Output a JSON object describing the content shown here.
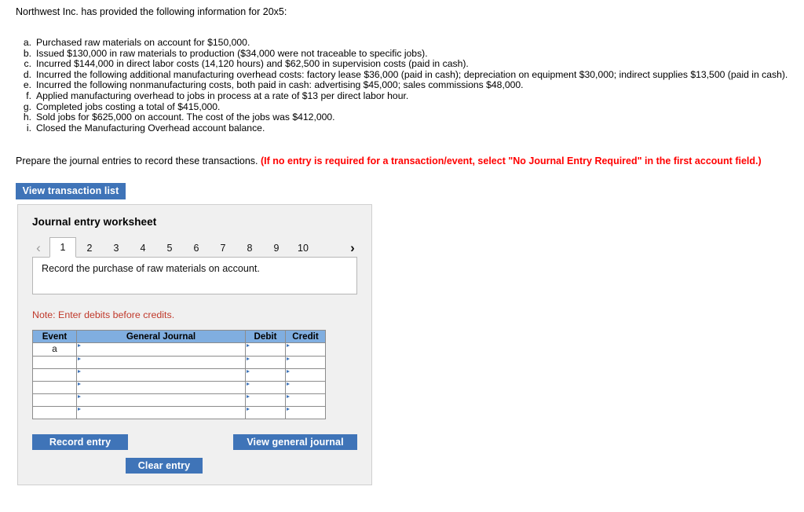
{
  "problem": {
    "intro": "Northwest Inc. has provided the following information for 20x5:",
    "facts": [
      {
        "marker": "a.",
        "text": "Purchased raw materials on account for $150,000."
      },
      {
        "marker": "b.",
        "text": "Issued $130,000 in raw materials to production ($34,000 were not traceable to specific jobs)."
      },
      {
        "marker": "c.",
        "text": "Incurred $144,000 in direct labor costs (14,120 hours) and $62,500 in supervision costs (paid in cash)."
      },
      {
        "marker": "d.",
        "text": "Incurred the following additional manufacturing overhead costs: factory lease $36,000 (paid  in cash); depreciation on equipment $30,000; indirect supplies $13,500 (paid in cash)."
      },
      {
        "marker": "e.",
        "text": "Incurred the following nonmanufacturing costs, both paid in cash: advertising $45,000; sales commissions $48,000."
      },
      {
        "marker": "f.",
        "text": "Applied manufacturing overhead to jobs in process at a rate of $13 per direct labor hour."
      },
      {
        "marker": "g.",
        "text": "Completed jobs costing a total of $415,000."
      },
      {
        "marker": "h.",
        "text": "Sold jobs for $625,000 on account. The cost of the jobs was $412,000."
      },
      {
        "marker": "i.",
        "text": "Closed the Manufacturing Overhead account balance."
      }
    ],
    "instruction": "Prepare the journal entries to record these transactions. ",
    "instruction_hint": "(If no entry is required for a transaction/event, select \"No Journal Entry Required\" in the first account field.)"
  },
  "view_transaction_list_label": "View transaction list",
  "worksheet": {
    "title": "Journal entry worksheet",
    "prev_arrow": "‹",
    "next_arrow": "›",
    "tabs": [
      "1",
      "2",
      "3",
      "4",
      "5",
      "6",
      "7",
      "8",
      "9",
      "10"
    ],
    "active_tab_index": 0,
    "prompt": "Record the purchase of raw materials on account.",
    "note": "Note: Enter debits before credits.",
    "table": {
      "headers": [
        "Event",
        "General Journal",
        "Debit",
        "Credit"
      ],
      "rows": [
        {
          "event": "a",
          "journal": "",
          "debit": "",
          "credit": ""
        },
        {
          "event": "",
          "journal": "",
          "debit": "",
          "credit": ""
        },
        {
          "event": "",
          "journal": "",
          "debit": "",
          "credit": ""
        },
        {
          "event": "",
          "journal": "",
          "debit": "",
          "credit": ""
        },
        {
          "event": "",
          "journal": "",
          "debit": "",
          "credit": ""
        },
        {
          "event": "",
          "journal": "",
          "debit": "",
          "credit": ""
        }
      ]
    },
    "buttons": {
      "record_entry": "Record entry",
      "clear_entry": "Clear entry",
      "view_general_journal": "View general journal"
    }
  },
  "colors": {
    "button_blue": "#3f74b8",
    "table_header_blue": "#80aee0",
    "note_red": "#c0392b",
    "hint_red": "#ff0000",
    "panel_bg": "#f0f0f0"
  }
}
